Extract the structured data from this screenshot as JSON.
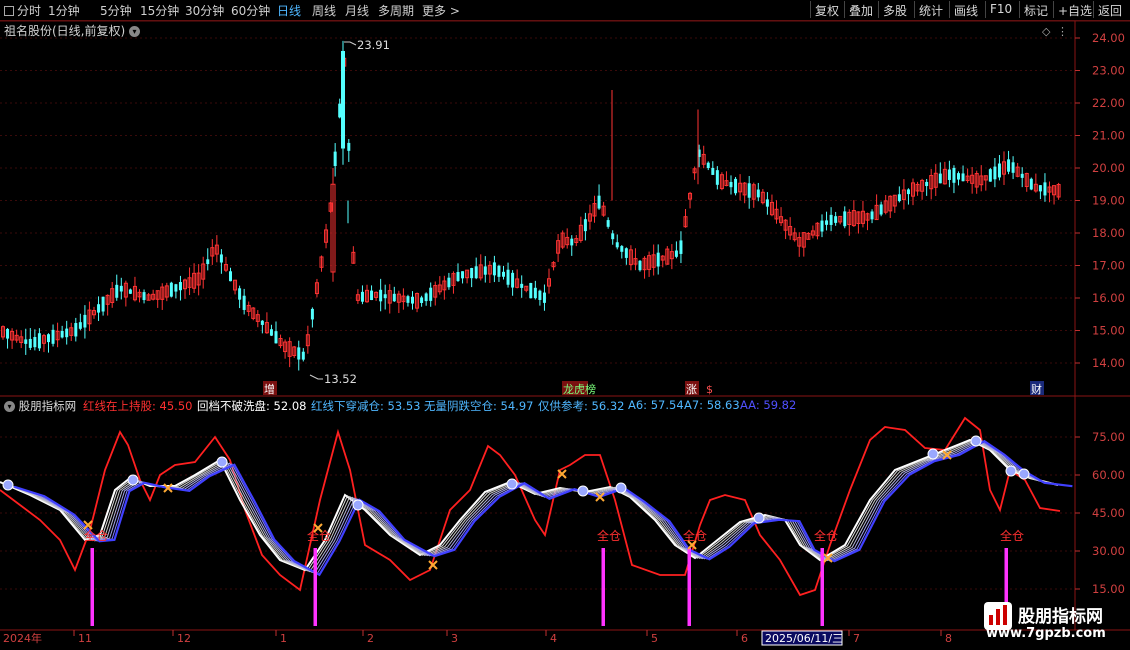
{
  "toolbar": {
    "timeframes": [
      "分时",
      "1分钟",
      "5分钟",
      "15分钟",
      "30分钟",
      "60分钟",
      "日线",
      "周线",
      "月线",
      "多周期",
      "更多 >"
    ],
    "active_timeframe": "日线",
    "buttons": [
      "复权",
      "叠加",
      "多股",
      "统计",
      "画线",
      "F10",
      "标记",
      "+自选",
      "返回"
    ]
  },
  "stock": {
    "name_label": "祖名股份(日线,前复权)",
    "high_label": "23.91",
    "low_label": "13.52"
  },
  "price_axis": [
    "24.00",
    "23.00",
    "22.00",
    "21.00",
    "20.00",
    "19.00",
    "18.00",
    "17.00",
    "16.00",
    "15.00",
    "14.00"
  ],
  "event_markers": [
    "增",
    "龙虎榜",
    "涨",
    "$",
    "财"
  ],
  "indicator": {
    "name": "股朋指标网",
    "items": [
      {
        "label": "红线在上持股: 45.50",
        "color": "#ff3030"
      },
      {
        "label": "回档不破洗盘: 52.08",
        "color": "#ffffff"
      },
      {
        "label": "红线下穿减仓: 53.53",
        "color": "#4fb7ff"
      },
      {
        "label": "无量阴跌空仓: 54.97",
        "color": "#4fb7ff"
      },
      {
        "label": "仅供参考: 56.32",
        "color": "#4fb7ff"
      },
      {
        "label": "A6: 57.54",
        "color": "#4fb7ff"
      },
      {
        "label": "A7: 58.63",
        "color": "#4fb7ff"
      },
      {
        "label": "AA: 59.82",
        "color": "#5050ff"
      }
    ],
    "axis": [
      "75.00",
      "60.00",
      "45.00",
      "30.00",
      "15.00"
    ],
    "signal_label": "全仓"
  },
  "date_axis": {
    "year_label": "2024年",
    "months": [
      "11",
      "12",
      "1",
      "2",
      "3",
      "4",
      "5",
      "6",
      "7",
      "8"
    ],
    "cursor_date": "2025/06/11/三"
  },
  "watermark": {
    "line1": "股朋指标网",
    "line2": "www.7gpzb.com"
  }
}
